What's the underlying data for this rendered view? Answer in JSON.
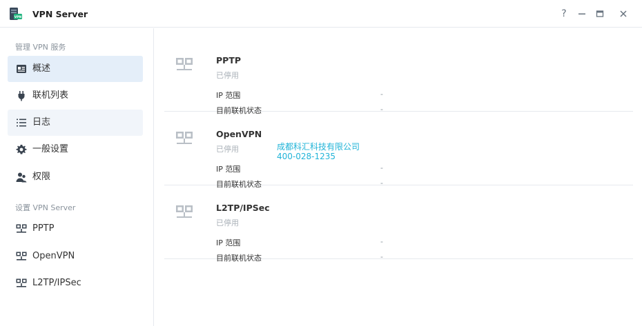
{
  "window": {
    "title": "VPN Server",
    "buttons": {
      "help": "?",
      "minimize": "—",
      "maximize": "▭",
      "close": "✕"
    }
  },
  "sidebar": {
    "section1": "管理 VPN 服务",
    "section2": "设置 VPN Server",
    "items": [
      {
        "label": "概述",
        "icon": "overview-icon"
      },
      {
        "label": "联机列表",
        "icon": "plug-icon"
      },
      {
        "label": "日志",
        "icon": "list-icon"
      },
      {
        "label": "一般设置",
        "icon": "gear-icon"
      },
      {
        "label": "权限",
        "icon": "users-icon"
      },
      {
        "label": "PPTP",
        "icon": "network-icon"
      },
      {
        "label": "OpenVPN",
        "icon": "network-icon"
      },
      {
        "label": "L2TP/IPSec",
        "icon": "network-icon"
      }
    ]
  },
  "services": [
    {
      "name": "PPTP",
      "status": "已停用",
      "ip_range_label": "IP 范围",
      "ip_range_value": "-",
      "conn_label": "目前联机状态",
      "conn_value": "-"
    },
    {
      "name": "OpenVPN",
      "status": "已停用",
      "ip_range_label": "IP 范围",
      "ip_range_value": "-",
      "conn_label": "目前联机状态",
      "conn_value": "-"
    },
    {
      "name": "L2TP/IPSec",
      "status": "已停用",
      "ip_range_label": "IP 范围",
      "ip_range_value": "-",
      "conn_label": "目前联机状态",
      "conn_value": "-"
    }
  ],
  "watermark": {
    "line1": "成都科汇科技有限公司",
    "line2": "400-028-1235"
  },
  "colors": {
    "accent": "#e4eef9",
    "hover": "#f1f5fa",
    "watermark": "#21b4d8",
    "icon": "#b9bfc6"
  }
}
